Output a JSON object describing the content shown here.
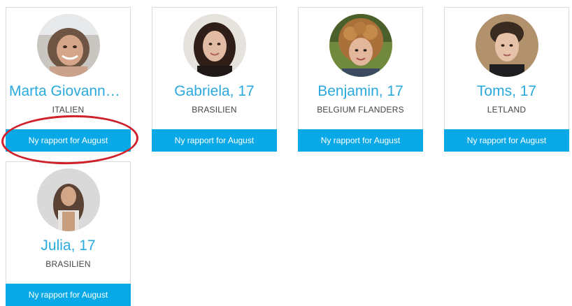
{
  "students": [
    {
      "name": "Marta Giovanna ...",
      "country": "ITALIEN",
      "button_label": "Ny rapport for August"
    },
    {
      "name": "Gabriela, 17",
      "country": "BRASILIEN",
      "button_label": "Ny rapport for August"
    },
    {
      "name": "Benjamin, 17",
      "country": "BELGIUM FLANDERS",
      "button_label": "Ny rapport for August"
    },
    {
      "name": "Toms, 17",
      "country": "LETLAND",
      "button_label": "Ny rapport for August"
    },
    {
      "name": "Julia, 17",
      "country": "BRASILIEN",
      "button_label": "Ny rapport for August"
    }
  ],
  "colors": {
    "accent_text": "#29a9dd",
    "button_bg": "#09a9e8",
    "annotation": "#d0202a"
  }
}
